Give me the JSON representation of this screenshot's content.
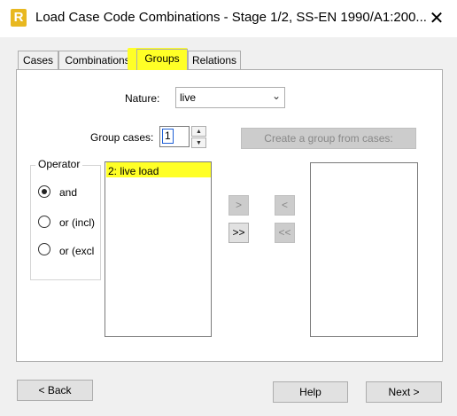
{
  "window": {
    "title": "Load Case Code Combinations - Stage 1/2, SS-EN 1990/A1:200...",
    "app_icon_letter": "R",
    "close_glyph": "✕"
  },
  "tabs": [
    {
      "label": "Cases",
      "active": false
    },
    {
      "label": "Combinations",
      "active": false
    },
    {
      "label": "Groups",
      "active": true
    },
    {
      "label": "Relations",
      "active": false
    }
  ],
  "form": {
    "nature_label": "Nature:",
    "nature_value": "live",
    "group_cases_label": "Group cases:",
    "group_cases_value": "1",
    "create_group_button": "Create a group from cases:"
  },
  "operator": {
    "title": "Operator",
    "options": [
      {
        "label": "and",
        "selected": true
      },
      {
        "label": "or (incl)",
        "selected": false
      },
      {
        "label": "or (excl",
        "selected": false
      }
    ]
  },
  "cases_list": {
    "items": [
      "2: live load"
    ]
  },
  "move_buttons": {
    "add": ">",
    "add_all": ">>",
    "remove": "<",
    "remove_all": "<<"
  },
  "footer": {
    "back": "< Back",
    "help": "Help",
    "next": "Next >"
  },
  "colors": {
    "highlight": "#ffff26",
    "app_icon": "#e8b820"
  }
}
